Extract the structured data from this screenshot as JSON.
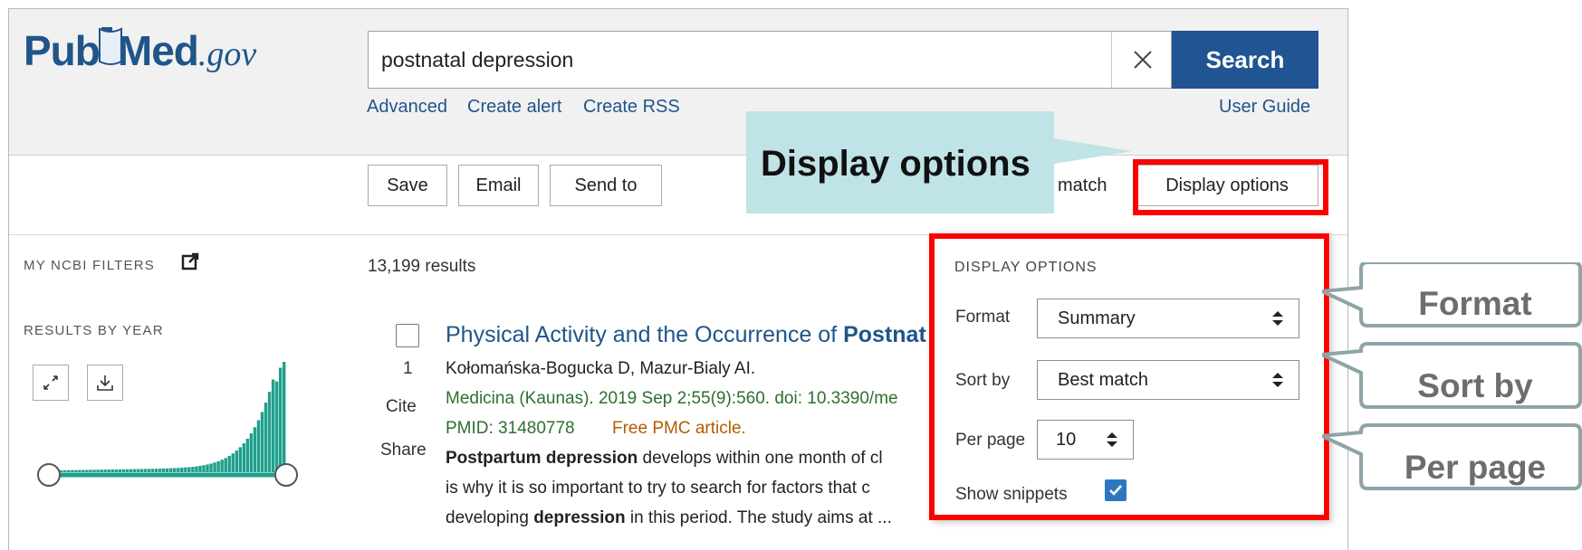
{
  "site": {
    "logo_pub": "Pub",
    "logo_med": "Med",
    "logo_gov": ".gov"
  },
  "search": {
    "query": "postnatal depression",
    "button_label": "Search",
    "links": {
      "advanced": "Advanced",
      "create_alert": "Create alert",
      "create_rss": "Create RSS",
      "user_guide": "User Guide"
    }
  },
  "toolbar": {
    "save": "Save",
    "email": "Email",
    "send_to": "Send to",
    "sort_partial": "match",
    "display_options": "Display options"
  },
  "sidebar": {
    "my_ncbi_filters": "MY NCBI FILTERS",
    "results_by_year": "RESULTS BY YEAR"
  },
  "results": {
    "count": "13,199 results",
    "items": [
      {
        "number": "1",
        "cite": "Cite",
        "share": "Share",
        "title_plain": "Physical Activity and the Occurrence of ",
        "title_bold": "Postnat",
        "authors": "Kołomańska-Bogucka D, Mazur-Bialy AI.",
        "citation": "Medicina (Kaunas). 2019 Sep 2;55(9):560. doi: 10.3390/me",
        "pmid": "PMID: 31480778",
        "free": "Free PMC article.",
        "snippet_1_bold": "Postpartum depression",
        "snippet_1_rest": " develops within one month of cl",
        "snippet_2": "is why it is so important to try to search for factors that c",
        "snippet_3_pre": "developing ",
        "snippet_3_bold": "depression",
        "snippet_3_post": " in this period. The study aims at ..."
      }
    ]
  },
  "display_options": {
    "heading": "DISPLAY OPTIONS",
    "format_label": "Format",
    "format_value": "Summary",
    "sort_label": "Sort by",
    "sort_value": "Best match",
    "per_page_label": "Per page",
    "per_page_value": "10",
    "snippets_label": "Show snippets",
    "show_snippets": true
  },
  "annotations": {
    "callout": "Display options",
    "format": "Format",
    "sort_by": "Sort by",
    "per_page": "Per page",
    "highlight_color": "#ff0000",
    "callout_color": "#bfe3e6"
  },
  "colors": {
    "brand_blue": "#205493",
    "link_blue": "#20558a",
    "histogram_teal": "#20a08c"
  }
}
